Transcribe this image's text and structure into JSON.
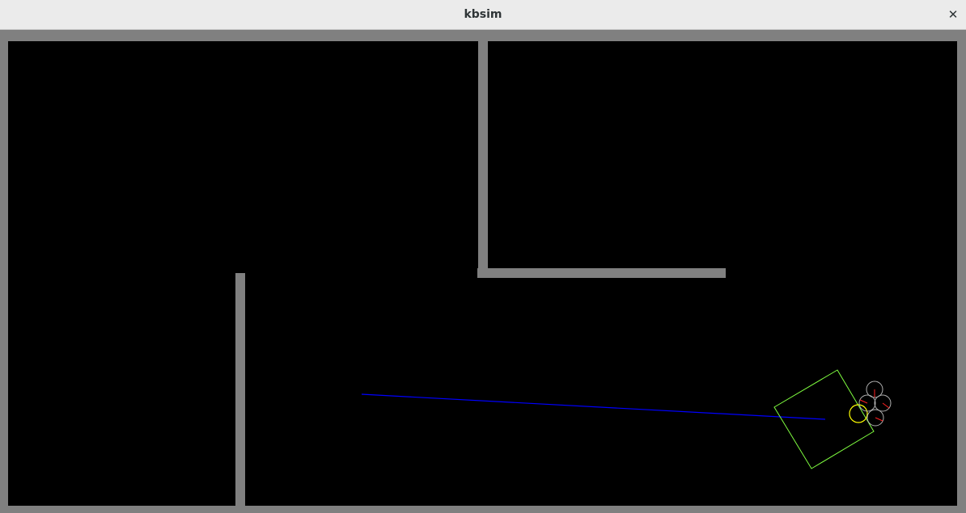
{
  "window": {
    "title": "kbsim",
    "close_glyph": "✕"
  },
  "colors": {
    "background": "#000000",
    "wall": "#808080",
    "trail": "#0000ff",
    "box": "#80ff40",
    "robot": "#b0b0b0",
    "leader": "#ffff00",
    "heading": "#ff2020"
  },
  "scene": {
    "robots": 5,
    "icons": [
      "close-icon"
    ]
  }
}
